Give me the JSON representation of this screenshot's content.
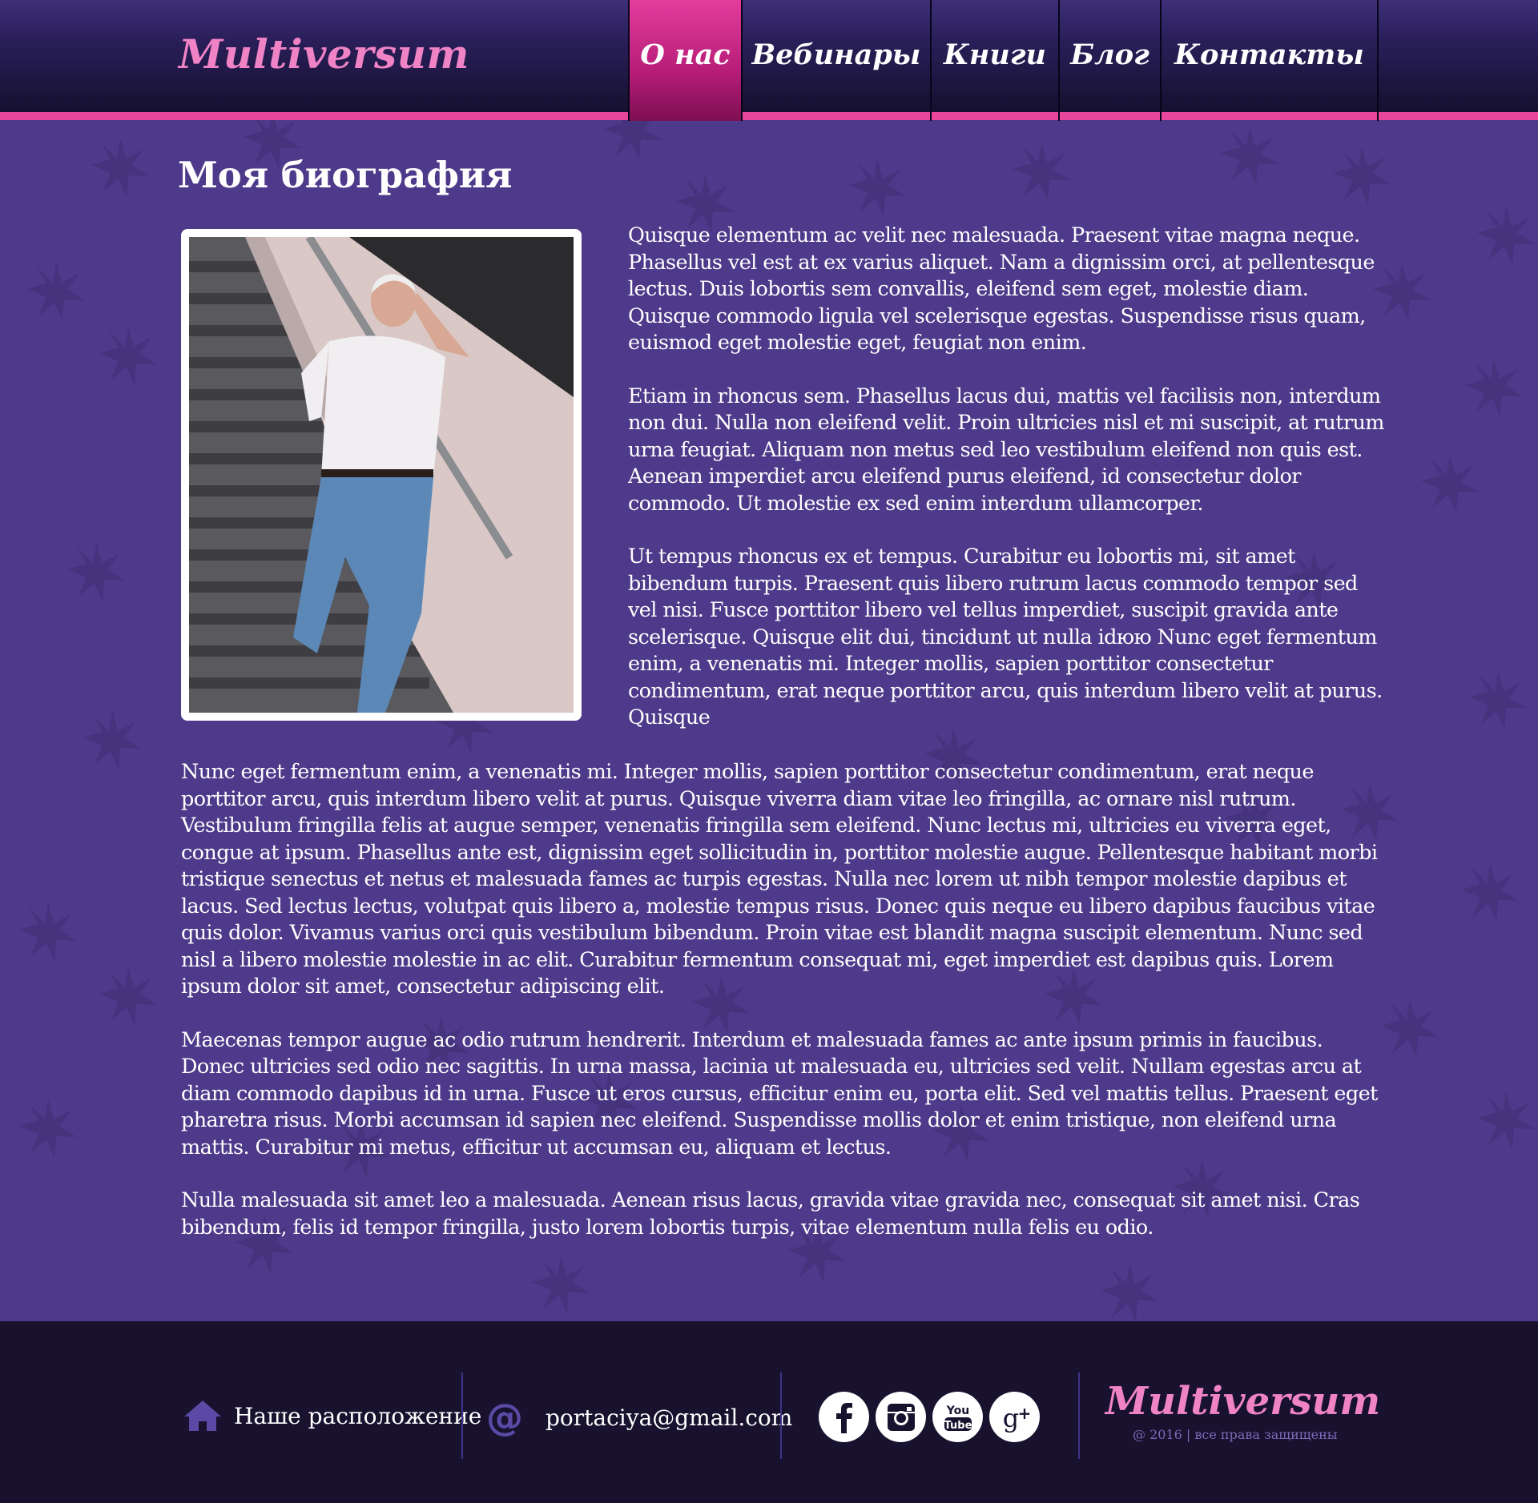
{
  "colors": {
    "background": "#4e3a8a",
    "header_dark": "#15102f",
    "accent_pink": "#e8459d",
    "logo_pink": "#f083c6",
    "footer": "#18122f",
    "footer_muted": "#7a6ab8"
  },
  "header": {
    "logo": "Multiversum",
    "nav": [
      {
        "label": "О нас",
        "active": true
      },
      {
        "label": "Вебинары",
        "active": false
      },
      {
        "label": "Книги",
        "active": false
      },
      {
        "label": "Блог",
        "active": false
      },
      {
        "label": "Контакты",
        "active": false
      }
    ]
  },
  "main": {
    "title": "Моя биография",
    "intro_paragraphs": [
      "Quisque elementum ac velit nec malesuada. Praesent vitae magna neque. Phasellus vel est at ex varius aliquet. Nam a dignissim orci, at pellentesque lectus. Duis lobortis sem convallis, eleifend sem eget, molestie diam. Quisque commodo ligula vel scelerisque egestas. Suspendisse risus quam, euismod eget molestie eget, feugiat non enim.",
      "Etiam in rhoncus sem. Phasellus lacus dui, mattis vel facilisis non, interdum non dui. Nulla non eleifend velit. Proin ultricies nisl et mi suscipit, at rutrum urna feugiat. Aliquam non metus sed leo vestibulum eleifend non quis est. Aenean imperdiet arcu eleifend purus eleifend, id consectetur dolor commodo. Ut molestie ex sed enim interdum ullamcorper.",
      "Ut tempus rhoncus ex et tempus. Curabitur eu lobortis mi, sit amet bibendum turpis. Praesent quis libero rutrum lacus commodo tempor sed vel nisi. Fusce porttitor libero vel tellus imperdiet, suscipit gravida ante scelerisque. Quisque elit dui, tincidunt ut nulla idюю Nunc eget fermentum enim, a venenatis mi. Integer mollis, sapien porttitor consectetur condimentum, erat neque porttitor arcu, quis interdum libero velit at purus. Quisque"
    ],
    "body_paragraphs": [
      "Nunc eget fermentum enim, a venenatis mi. Integer mollis, sapien porttitor consectetur condimentum, erat neque porttitor arcu, quis interdum libero velit at purus. Quisque viverra diam vitae leo fringilla, ac ornare nisl rutrum. Vestibulum fringilla felis at augue semper, venenatis fringilla sem eleifend. Nunc lectus mi, ultricies eu viverra eget, congue at ipsum. Phasellus ante est, dignissim eget sollicitudin in, porttitor molestie augue. Pellentesque habitant morbi tristique senectus et netus et malesuada fames ac turpis egestas. Nulla nec lorem ut nibh tempor molestie dapibus et lacus. Sed lectus lectus, volutpat quis libero a, molestie tempus risus. Donec quis neque eu libero dapibus faucibus vitae quis dolor. Vivamus varius orci quis vestibulum bibendum. Proin vitae est blandit magna suscipit elementum. Nunc sed nisl a libero molestie molestie in ac elit. Curabitur fermentum consequat mi, eget imperdiet est dapibus quis. Lorem ipsum dolor sit amet, consectetur adipiscing elit.",
      "Maecenas tempor augue ac odio rutrum hendrerit. Interdum et malesuada fames ac ante ipsum primis in faucibus. Donec ultricies sed odio nec sagittis. In urna massa, lacinia ut malesuada eu, ultricies sed velit. Nullam egestas arcu at diam commodo dapibus id in urna. Fusce ut eros cursus, efficitur enim eu, porta elit. Sed vel mattis tellus. Praesent eget pharetra risus. Morbi accumsan id sapien nec eleifend. Suspendisse mollis dolor et enim tristique, non eleifend urna mattis. Curabitur mi metus, efficitur ut accumsan eu, aliquam et lectus.",
      "Nulla malesuada sit amet leo a malesuada. Aenean risus lacus, gravida vitae gravida nec, consequat sit amet nisi. Cras bibendum, felis id tempor fringilla, justo lorem lobortis turpis, vitae elementum nulla felis eu odio."
    ]
  },
  "footer": {
    "location_label": "Наше расположение",
    "email": "portaciya@gmail.com",
    "socials": [
      "facebook-icon",
      "instagram-icon",
      "youtube-icon",
      "google-plus-icon"
    ],
    "logo": "Multiversum",
    "copyright": "@ 2016 | все права защищены"
  }
}
